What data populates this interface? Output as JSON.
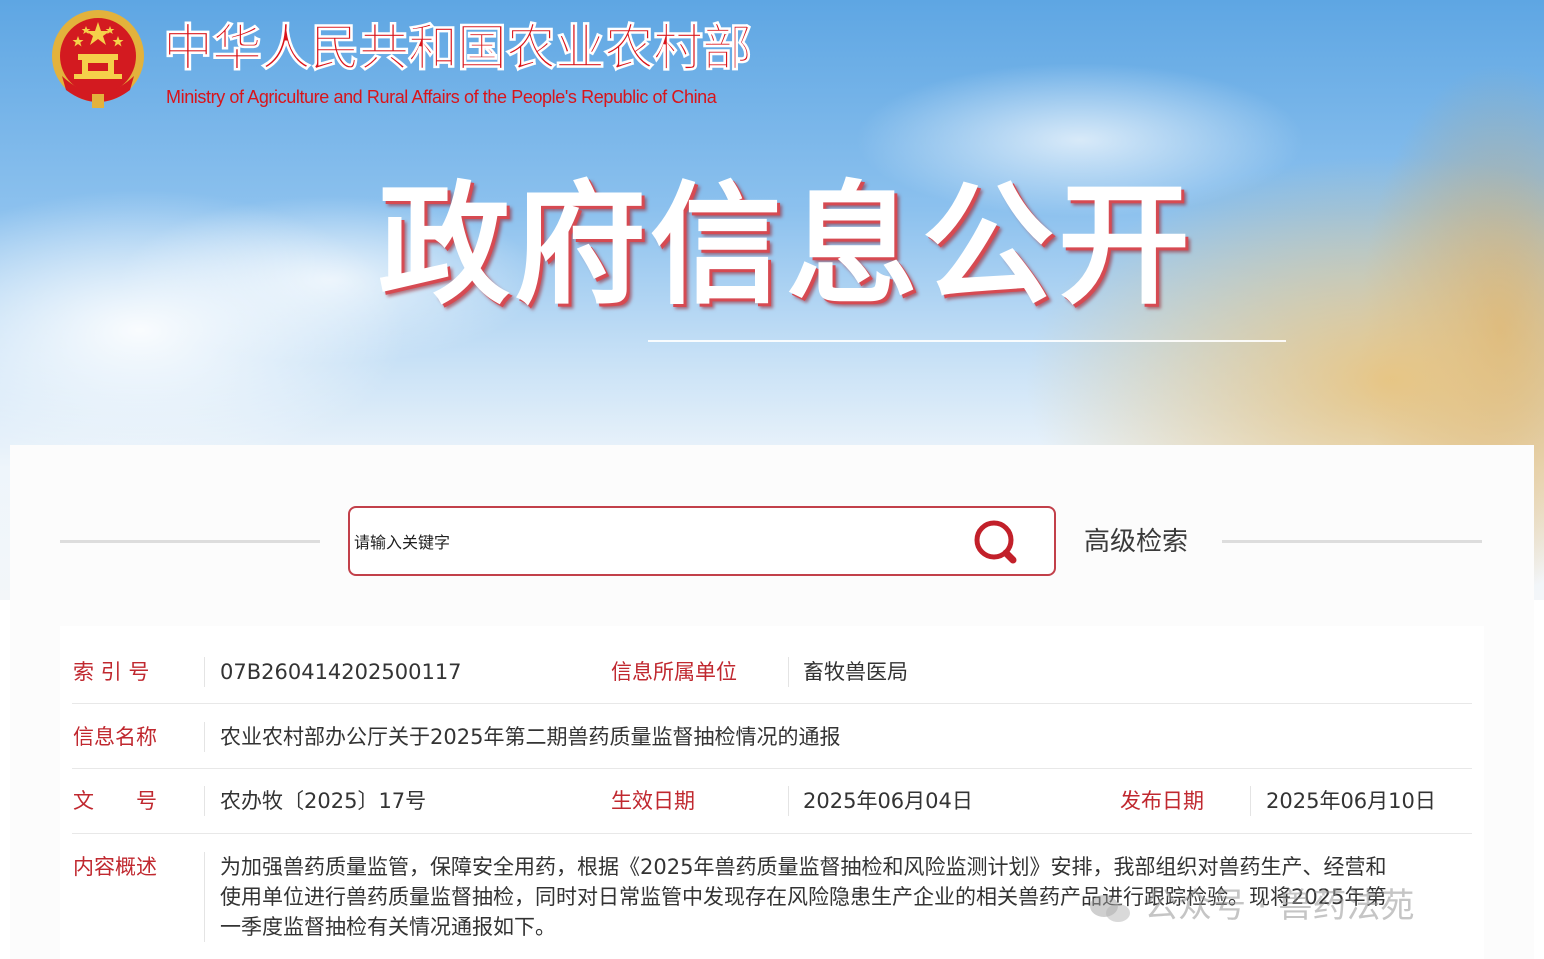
{
  "header": {
    "ministry_cn": "中华人民共和国农业农村部",
    "ministry_en": "Ministry of Agriculture and Rural Affairs of the People's Republic of China",
    "banner_title": "政府信息公开",
    "emblem_icon": "national-emblem-icon"
  },
  "search": {
    "placeholder": "请输入关键字",
    "search_icon": "search-icon",
    "advanced_label": "高级检索"
  },
  "info": {
    "index_label": "索 引 号",
    "index_value": "07B260414202500117",
    "unit_label": "信息所属单位",
    "unit_value": "畜牧兽医局",
    "name_label": "信息名称",
    "name_value": "农业农村部办公厅关于2025年第二期兽药质量监督抽检情况的通报",
    "docno_label": "文　　号",
    "docno_value": "农办牧〔2025〕17号",
    "effective_label": "生效日期",
    "effective_value": "2025年06月04日",
    "publish_label": "发布日期",
    "publish_value": "2025年06月10日",
    "summary_label": "内容概述",
    "summary_lines": [
      "为加强兽药质量监管，保障安全用药，根据《2025年兽药质量监督抽检和风险监测计划》安排，我部组织对兽药生产、经营和",
      "使用单位进行兽药质量监督抽检，同时对日常监管中发现存在风险隐患生产企业的相关兽药产品进行跟踪检验。现将2025年第",
      "一季度监督抽检有关情况通报如下。"
    ]
  },
  "watermark": {
    "text": "公众号 · 兽药法苑",
    "icon": "wechat-icon"
  },
  "colors": {
    "brand_red": "#d9141a",
    "label_red": "#c0282f",
    "search_border": "#c2404a"
  }
}
